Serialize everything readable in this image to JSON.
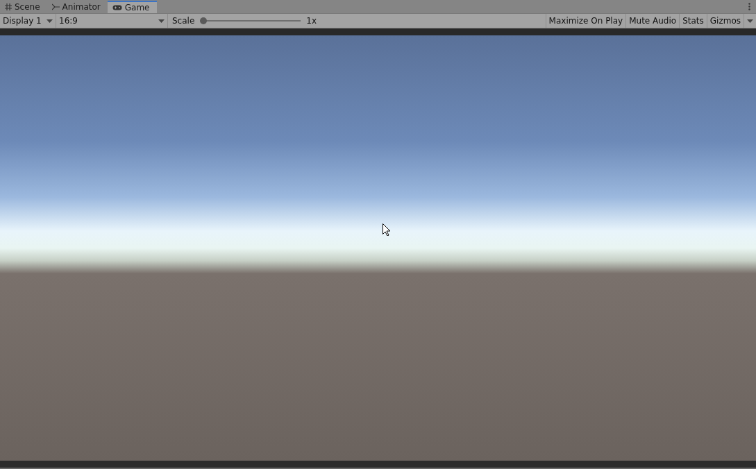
{
  "tabs": [
    {
      "label": "Scene",
      "selected": false
    },
    {
      "label": "Animator",
      "selected": false
    },
    {
      "label": "Game",
      "selected": true
    }
  ],
  "toolbar": {
    "display": "Display 1",
    "aspect": "16:9",
    "scale": {
      "label": "Scale",
      "level": 0,
      "reading": "1x"
    },
    "toggles": [
      {
        "label": "Maximize On Play",
        "on": false
      },
      {
        "label": "Mute Audio",
        "on": false
      },
      {
        "label": "Stats",
        "on": false
      },
      {
        "label": "Gizmos",
        "on": false
      }
    ]
  }
}
